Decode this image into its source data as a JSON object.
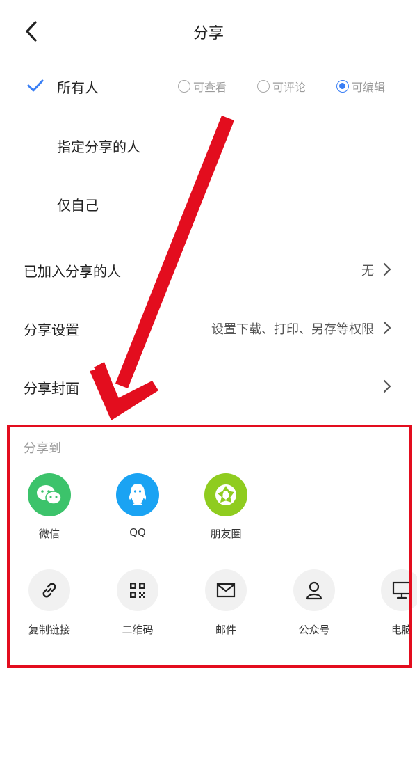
{
  "header": {
    "title": "分享"
  },
  "permission_options": [
    {
      "label": "所有人",
      "selected": true
    },
    {
      "label": "指定分享的人",
      "selected": false
    },
    {
      "label": "仅自己",
      "selected": false
    }
  ],
  "access_levels": [
    {
      "label": "可查看",
      "checked": false
    },
    {
      "label": "可评论",
      "checked": false
    },
    {
      "label": "可编辑",
      "checked": true
    }
  ],
  "settings": [
    {
      "label": "已加入分享的人",
      "value": "无"
    },
    {
      "label": "分享设置",
      "value": "设置下载、打印、另存等权限"
    },
    {
      "label": "分享封面",
      "value": ""
    }
  ],
  "share_to": {
    "title": "分享到",
    "apps": [
      {
        "label": "微信",
        "icon": "wechat-icon",
        "color": "#3cc36b"
      },
      {
        "label": "QQ",
        "icon": "qq-icon",
        "color": "#1aa3f3"
      },
      {
        "label": "朋友圈",
        "icon": "moments-icon",
        "color": "#8fcc1f"
      }
    ],
    "tools": [
      {
        "label": "复制链接",
        "icon": "link-icon"
      },
      {
        "label": "二维码",
        "icon": "qrcode-icon"
      },
      {
        "label": "邮件",
        "icon": "mail-icon"
      },
      {
        "label": "公众号",
        "icon": "person-icon"
      },
      {
        "label": "电脑",
        "icon": "monitor-icon"
      }
    ]
  },
  "colors": {
    "accent": "#3a7ff5",
    "annotation_red": "#e30d1e"
  }
}
